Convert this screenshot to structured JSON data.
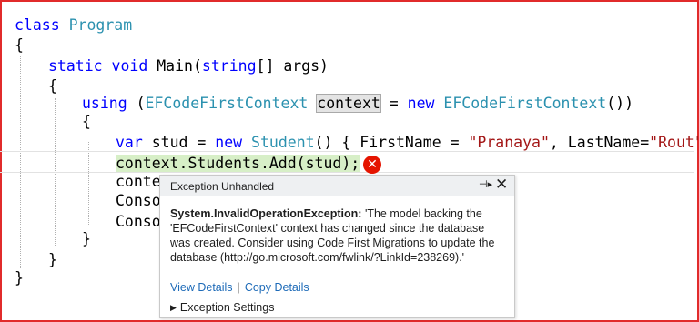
{
  "code": {
    "line1": {
      "kw": "class",
      "name": "Program"
    },
    "line2": "{",
    "line3": {
      "kw1": "static",
      "kw2": "void",
      "rest": "Main(",
      "kw3": "string",
      "rest2": "[] args)"
    },
    "line4": "{",
    "line5": {
      "kw": "using",
      "open": "(",
      "type": "EFCodeFirstContext",
      "var": "context",
      "eq": "=",
      "kw2": "new",
      "type2": "EFCodeFirstContext",
      "close": "())"
    },
    "line6": "{",
    "line7": {
      "kw": "var",
      "part1": "stud =",
      "kw2": "new",
      "type": "Student",
      "part2": "() { FirstName =",
      "str1": "\"Pranaya\"",
      "part3": ", LastName=",
      "str2": "\"Rout\"",
      "part4": "};"
    },
    "line8": "context.Students.Add(stud);",
    "line9": "conte",
    "line10": "Conso",
    "line11": "Conso",
    "line12": "}",
    "line13": "}",
    "line14": "}"
  },
  "error_icon": {
    "icon": "error-x-icon",
    "glyph": "✕",
    "color": "#e51400"
  },
  "popup": {
    "title": "Exception Unhandled",
    "pin_glyph": "⊣▸",
    "close_glyph": "✕",
    "exception_type": "System.InvalidOperationException:",
    "message": "'The model backing the 'EFCodeFirstContext' context has changed since the database was created. Consider using Code First Migrations to update the database (http://go.microsoft.com/fwlink/?LinkId=238269).'",
    "view_details": "View Details",
    "separator": "|",
    "copy_details": "Copy Details",
    "settings_glyph": "▶",
    "settings": "Exception Settings"
  },
  "colors": {
    "frame": "#e12b2b",
    "keyword": "#0000ff",
    "type": "#2b91af",
    "string": "#a31515",
    "link": "#1e6bb8"
  }
}
